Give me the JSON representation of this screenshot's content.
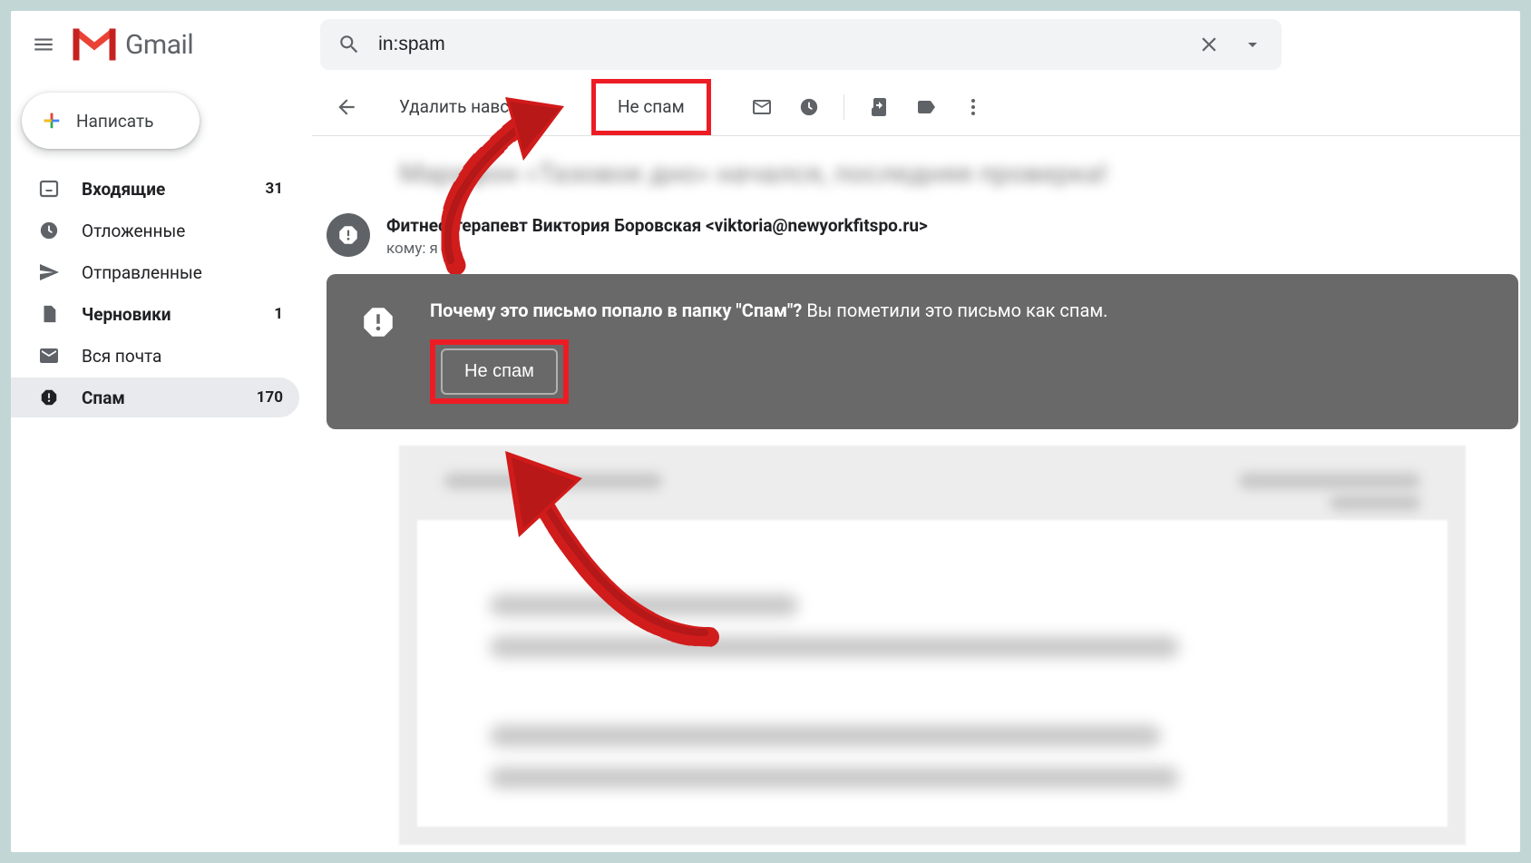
{
  "header": {
    "app_name": "Gmail",
    "search_value": "in:spam"
  },
  "sidebar": {
    "compose_label": "Написать",
    "items": [
      {
        "icon": "inbox",
        "label": "Входящие",
        "count": "31",
        "bold": true,
        "active": false
      },
      {
        "icon": "clock",
        "label": "Отложенные",
        "count": "",
        "bold": false,
        "active": false
      },
      {
        "icon": "send",
        "label": "Отправленные",
        "count": "",
        "bold": false,
        "active": false
      },
      {
        "icon": "file",
        "label": "Черновики",
        "count": "1",
        "bold": true,
        "active": false
      },
      {
        "icon": "mail",
        "label": "Вся почта",
        "count": "",
        "bold": false,
        "active": false
      },
      {
        "icon": "spam",
        "label": "Спам",
        "count": "170",
        "bold": true,
        "active": true
      }
    ]
  },
  "toolbar": {
    "delete_forever_label": "Удалить навсегда",
    "not_spam_label": "Не спам"
  },
  "email": {
    "subject_blurred": "Марафон «Тазовое дно» начался, последняя проверка!",
    "sender_name": "Фитнес-терапевт Виктория Боровская <viktoria@newyorkfitspo.ru>",
    "recipient_prefix": "кому:",
    "recipient": "я"
  },
  "spam_banner": {
    "question": "Почему это письмо попало в папку \"Спам\"?",
    "reason": "Вы пометили это письмо как спам.",
    "button_label": "Не спам"
  }
}
